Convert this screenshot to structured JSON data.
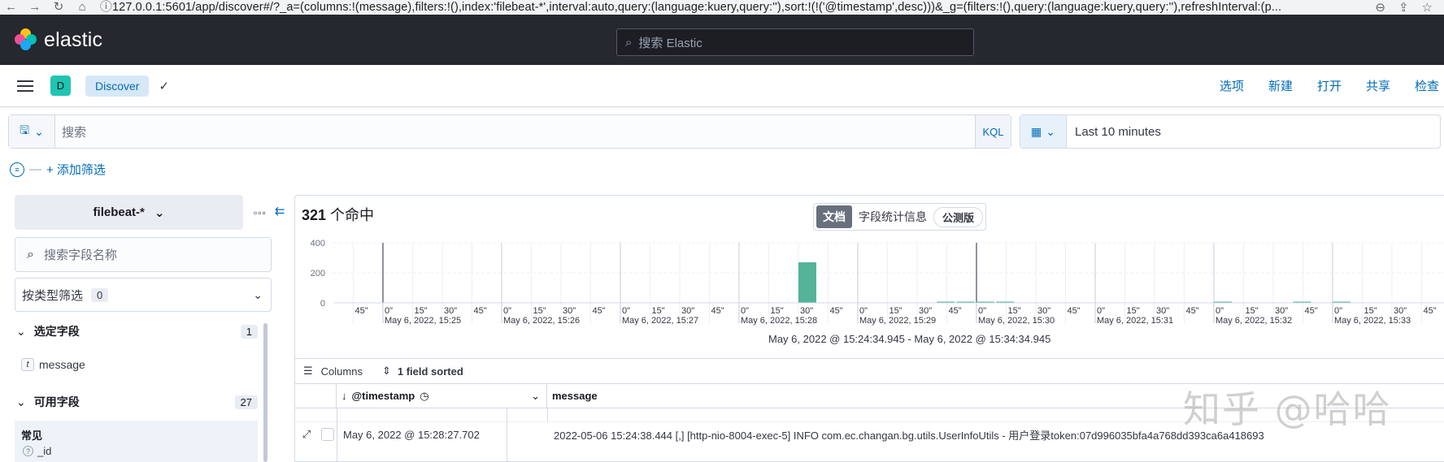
{
  "browser": {
    "url": "127.0.0.1:5601/app/discover#/?_a=(columns:!(message),filters:!(),index:'filebeat-*',interval:auto,query:(language:kuery,query:''),sort:!(!('@timestamp',desc)))&_g=(filters:!(),query:(language:kuery,query:''),refreshInterval:(p..."
  },
  "header": {
    "logo_text": "elastic",
    "search_placeholder": "搜索 Elastic"
  },
  "appbar": {
    "space_initial": "D",
    "breadcrumb": "Discover",
    "links": [
      "选项",
      "新建",
      "打开",
      "共享",
      "检查"
    ]
  },
  "query": {
    "placeholder": "搜索",
    "language": "KQL",
    "time_range": "Last 10 minutes"
  },
  "filters": {
    "add_label": "+ 添加筛选"
  },
  "sidebar": {
    "index_pattern": "filebeat-*",
    "field_search_placeholder": "搜索字段名称",
    "type_filter_label": "按类型筛选",
    "type_filter_count": "0",
    "selected_section": {
      "label": "选定字段",
      "count": "1"
    },
    "selected_fields": [
      {
        "type": "t",
        "name": "message"
      }
    ],
    "available_section": {
      "label": "可用字段",
      "count": "27"
    },
    "common_label": "常见",
    "common_fields": [
      {
        "type": "?",
        "name": "_id"
      }
    ]
  },
  "main": {
    "hits_count": "321",
    "hits_label": " 个命中",
    "tab_documents": "文档",
    "tab_field_stats": "字段统计信息",
    "beta_badge": "公测版",
    "date_range": "May 6, 2022 @ 15:24:34.945 - May 6, 2022 @ 15:34:34.945",
    "columns_label": "Columns",
    "sorted_label": "1 field sorted",
    "column_headers": [
      "@timestamp",
      "message"
    ],
    "rows": [
      {
        "timestamp": "May 6, 2022 @ 15:28:27.702",
        "message": "2022-05-06 15:24:38.444 [,] [http-nio-8004-exec-5] INFO com.ec.changan.bg.utils.UserInfoUtils - 用户登录token:07d996035bfa4a768dd393ca6a418693"
      }
    ]
  },
  "chart_data": {
    "type": "bar",
    "ylim": [
      0,
      400
    ],
    "y_ticks": [
      "400",
      "200",
      "0"
    ],
    "x_tick_labels": [
      "30\"",
      "45\"",
      "0\"",
      "15\"",
      "30\"",
      "45\""
    ],
    "minute_labels": [
      "May 6, 2022, 15:25",
      "May 6, 2022, 15:26",
      "May 6, 2022, 15:27",
      "May 6, 2022, 15:28",
      "May 6, 2022, 15:29",
      "May 6, 2022, 15:30",
      "May 6, 2022, 15:31",
      "May 6, 2022, 15:32",
      "May 6, 2022, 15:33"
    ],
    "bars": [
      {
        "x": "15:28:30",
        "value": 270
      },
      {
        "x": "15:29:40",
        "value": 8
      },
      {
        "x": "15:29:50",
        "value": 8
      },
      {
        "x": "15:30:00",
        "value": 8
      },
      {
        "x": "15:30:10",
        "value": 8
      },
      {
        "x": "15:32:00",
        "value": 8
      },
      {
        "x": "15:32:40",
        "value": 8
      },
      {
        "x": "15:33:00",
        "value": 8
      }
    ],
    "bar_color": "#54b399",
    "grid": true
  },
  "watermark": "知乎 @哈哈"
}
